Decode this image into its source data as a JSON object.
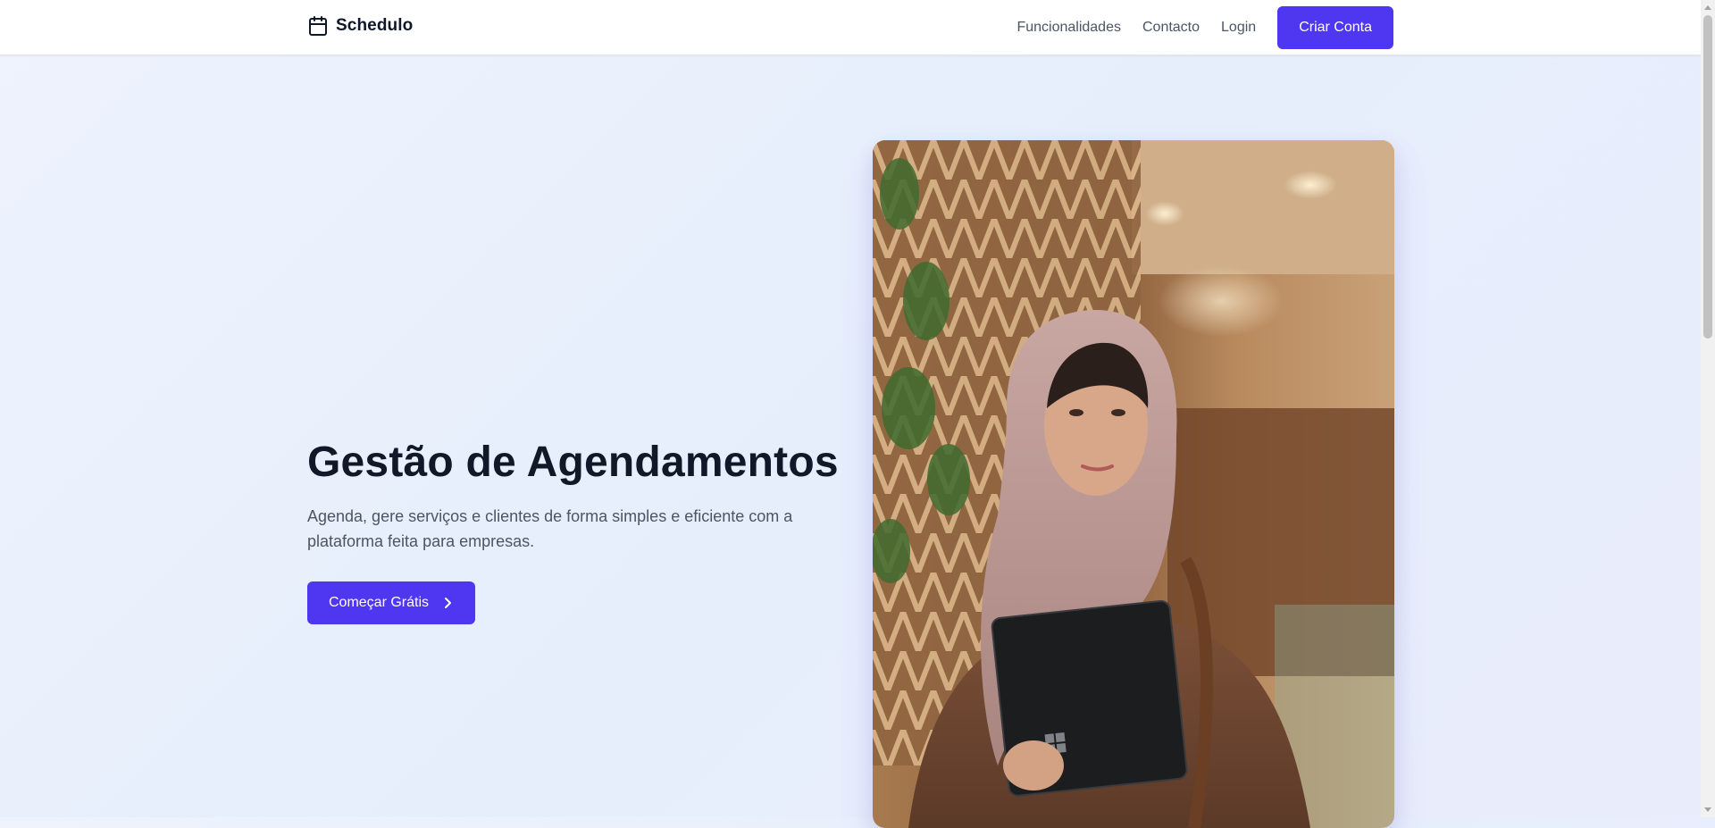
{
  "navbar": {
    "brand_icon": "calendar-icon",
    "brand_name": "Schedulo",
    "links": [
      {
        "label": "Funcionalidades"
      },
      {
        "label": "Contacto"
      },
      {
        "label": "Login"
      }
    ],
    "cta_label": "Criar Conta"
  },
  "hero": {
    "title": "Gestão de Agendamentos",
    "subtitle": "Agenda, gere serviços e clientes de forma simples e eficiente com a plataforma feita para empresas.",
    "cta_label": "Começar Grátis",
    "cta_icon": "chevron-right-icon"
  },
  "colors": {
    "accent": "#4f36f0",
    "heading": "#111827",
    "body_text": "#4b5563",
    "background": "#e9effc"
  }
}
